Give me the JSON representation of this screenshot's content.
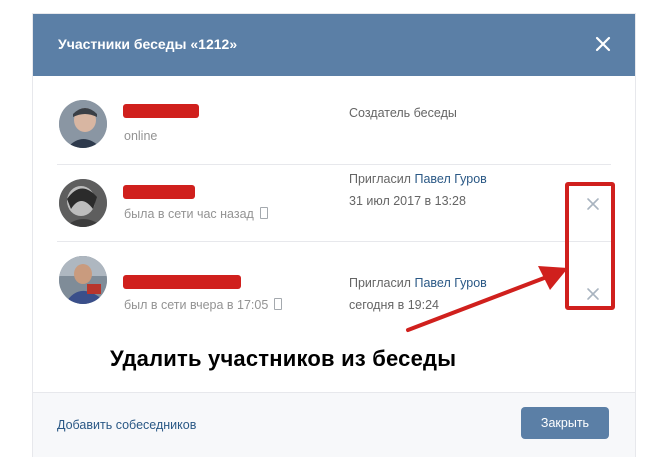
{
  "dialog": {
    "title": "Участники беседы «1212»",
    "close_icon": "close-icon"
  },
  "members": [
    {
      "status": "online",
      "mobile": false,
      "role_line1": "Создатель беседы",
      "invited_by": "",
      "date": "",
      "removable": false
    },
    {
      "status": "была в сети час назад",
      "mobile": true,
      "role_line1": "Пригласил",
      "invited_by": "Павел Гуров",
      "date": "31 июл 2017 в 13:28",
      "removable": true
    },
    {
      "status": "был в сети вчера в 17:05",
      "mobile": true,
      "role_line1": "Пригласил",
      "invited_by": "Павел Гуров",
      "date": "сегодня в 19:24",
      "removable": true
    }
  ],
  "annotation": {
    "text": "Удалить участников из беседы",
    "highlight_color": "#d0201d"
  },
  "footer": {
    "add_link": "Добавить собеседников",
    "close_button": "Закрыть"
  },
  "colors": {
    "header": "#5b7fa6",
    "link": "#2a5885",
    "redaction": "#d0201d"
  }
}
